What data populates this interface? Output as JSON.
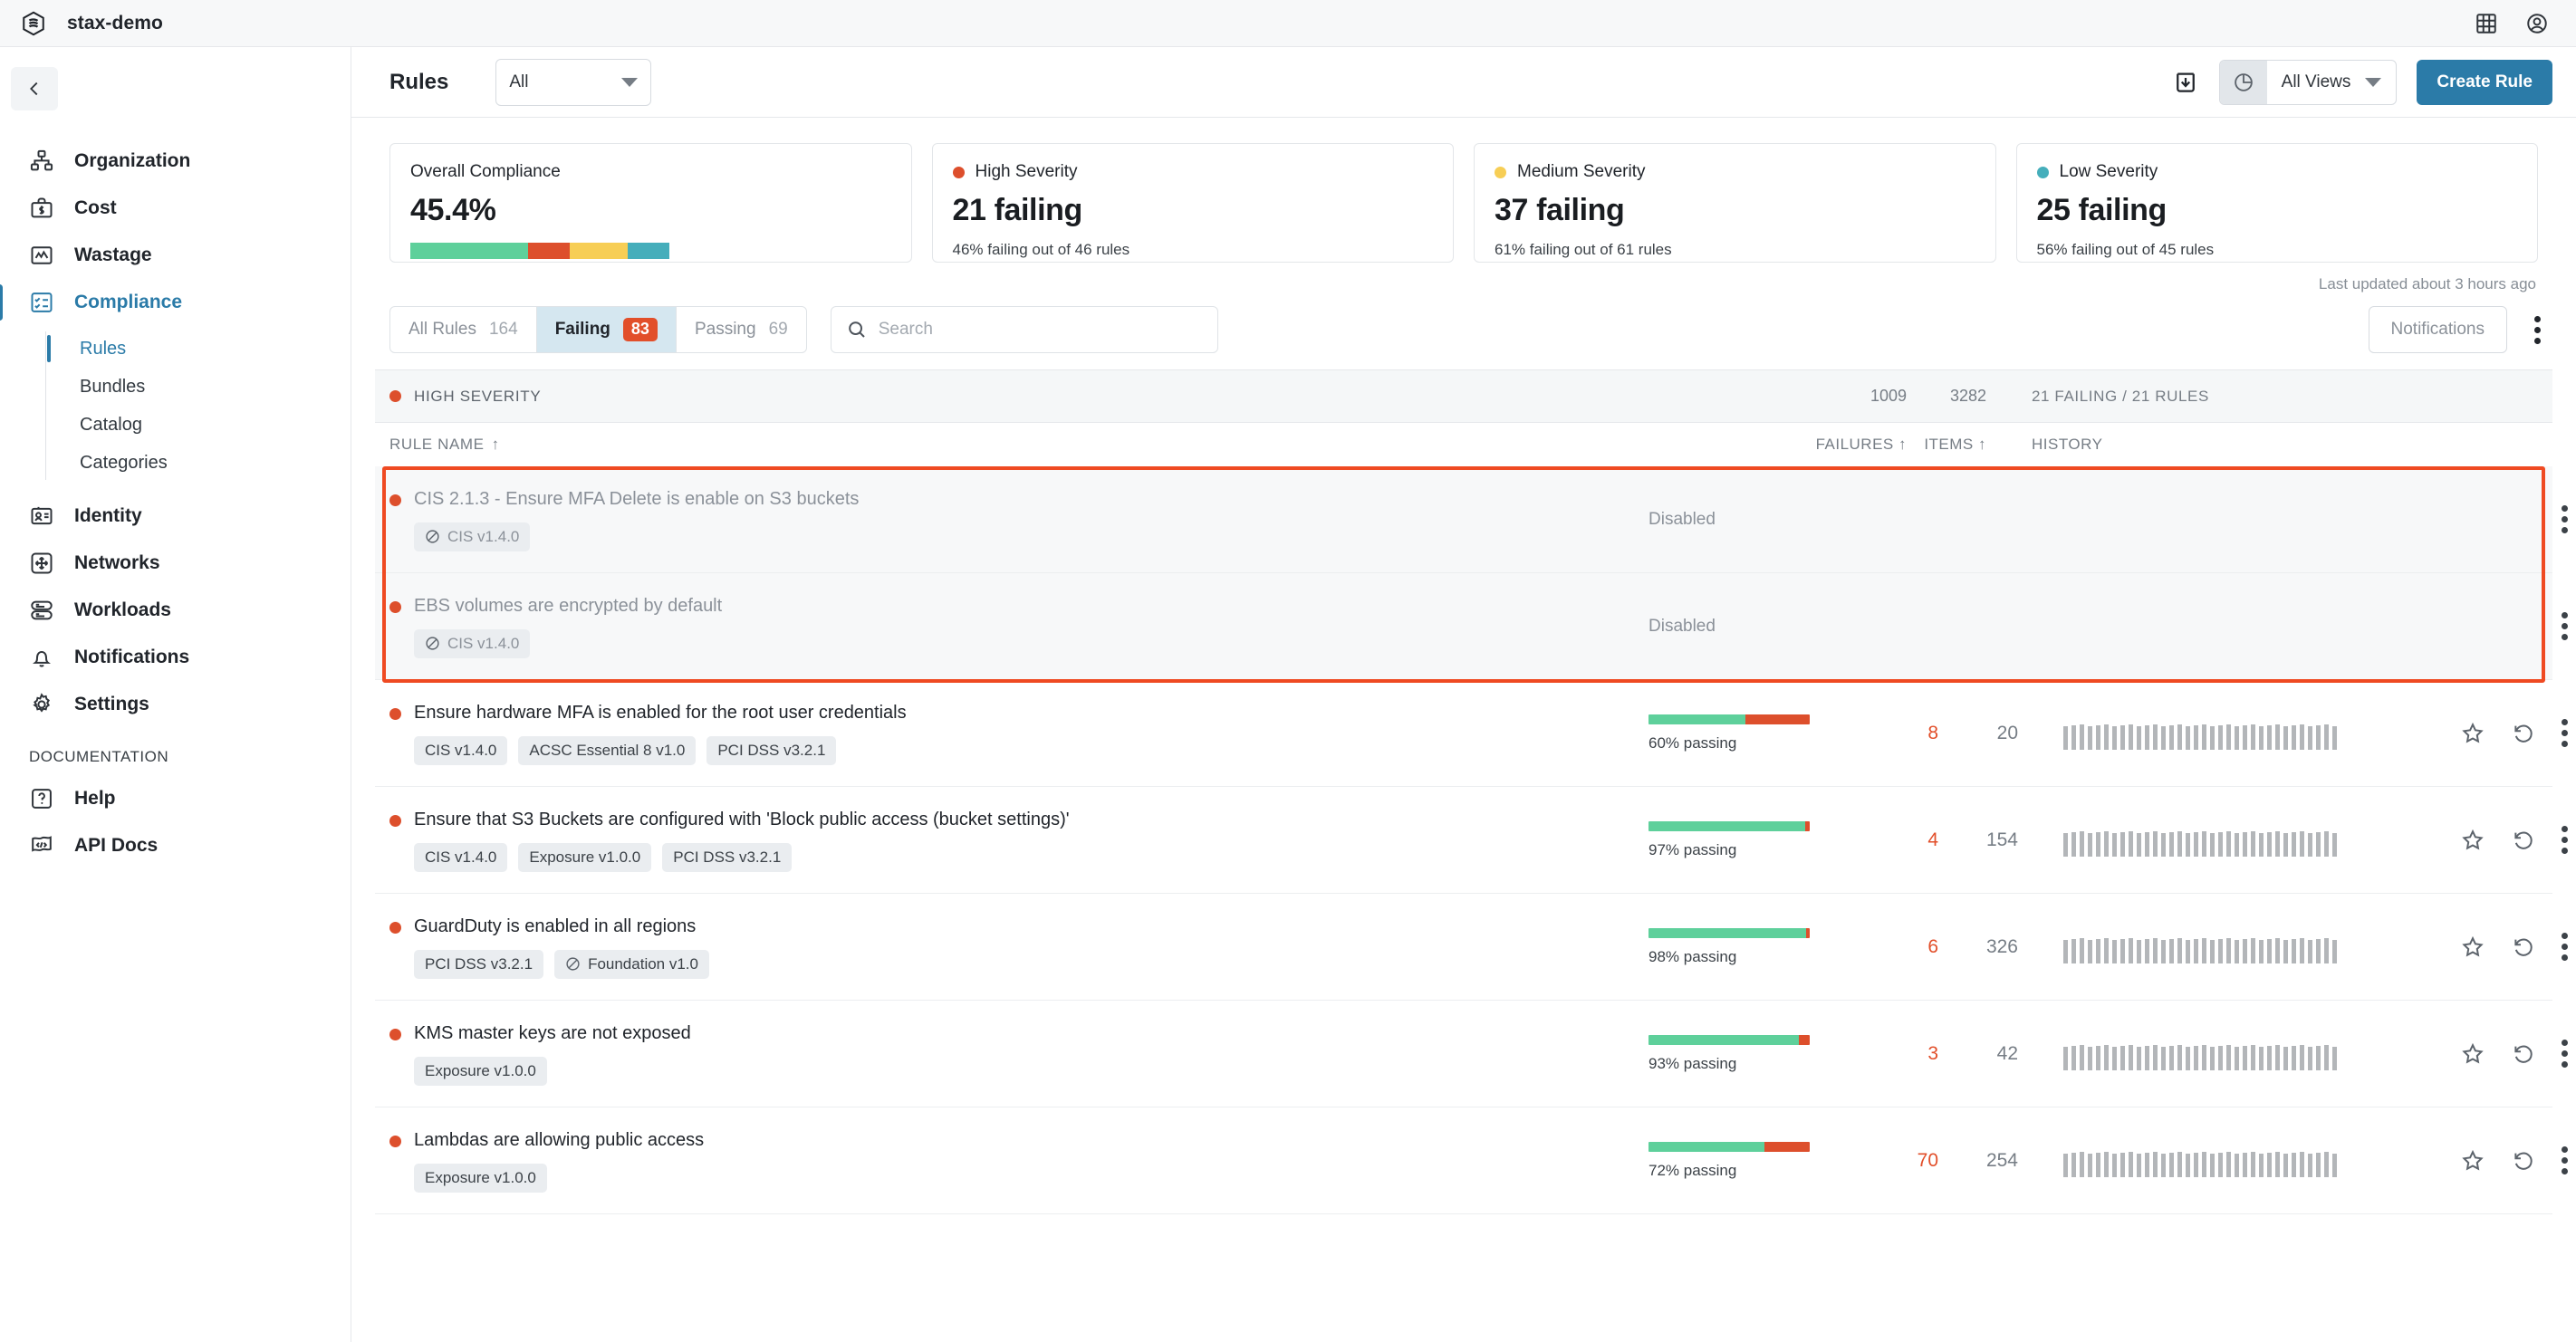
{
  "topbar": {
    "brand_name": "stax-demo",
    "logo_icon": "stax-hexagon-logo",
    "grid_icon": "apps-grid-icon",
    "account_icon": "account-circle-icon"
  },
  "sidebar": {
    "collapse_icon": "chevron-left-icon",
    "items": [
      {
        "label": "Organization",
        "icon": "org-chart-icon"
      },
      {
        "label": "Cost",
        "icon": "briefcase-dollar-icon"
      },
      {
        "label": "Wastage",
        "icon": "chart-line-icon"
      },
      {
        "label": "Compliance",
        "icon": "checklist-icon",
        "active": true
      }
    ],
    "subitems": [
      {
        "label": "Rules",
        "active": true
      },
      {
        "label": "Bundles",
        "active": false
      },
      {
        "label": "Catalog",
        "active": false
      },
      {
        "label": "Categories",
        "active": false
      }
    ],
    "items2": [
      {
        "label": "Identity",
        "icon": "id-card-icon"
      },
      {
        "label": "Networks",
        "icon": "arrows-move-icon"
      },
      {
        "label": "Workloads",
        "icon": "server-stack-icon"
      },
      {
        "label": "Notifications",
        "icon": "bell-icon"
      },
      {
        "label": "Settings",
        "icon": "gear-icon"
      }
    ],
    "section_title": "DOCUMENTATION",
    "items3": [
      {
        "label": "Help",
        "icon": "question-box-icon"
      },
      {
        "label": "API Docs",
        "icon": "code-flag-icon"
      }
    ]
  },
  "header": {
    "title": "Rules",
    "filter_value": "All",
    "download_icon": "download-box-icon",
    "views_icon": "pie-chart-icon",
    "views_label": "All Views",
    "create_button": "Create Rule"
  },
  "cards": [
    {
      "label": "Overall Compliance",
      "value": "45.4%",
      "has_bar": true,
      "segments": [
        {
          "pct": 45.4,
          "color": "#5ed09b"
        },
        {
          "pct": 16.0,
          "color": "#dd4f2c"
        },
        {
          "pct": 22.6,
          "color": "#f7ce55"
        },
        {
          "pct": 16.0,
          "color": "#45aebb"
        }
      ]
    },
    {
      "label": "High Severity",
      "dot": "#dd4f2c",
      "value": "21 failing",
      "sub": "46% failing out of 46 rules"
    },
    {
      "label": "Medium Severity",
      "dot": "#f7ce55",
      "value": "37 failing",
      "sub": "61% failing out of 61 rules"
    },
    {
      "label": "Low Severity",
      "dot": "#45aebb",
      "value": "25 failing",
      "sub": "56% failing out of 45 rules"
    }
  ],
  "last_updated": "Last updated about 3 hours ago",
  "filters": {
    "tabs": [
      {
        "label": "All Rules",
        "count": "164",
        "active": false
      },
      {
        "label": "Failing",
        "badge": "83",
        "active": true
      },
      {
        "label": "Passing",
        "count": "69",
        "active": false
      }
    ],
    "search_placeholder": "Search",
    "search_value": "",
    "search_icon": "search-icon",
    "notifications_button": "Notifications",
    "more_icon": "kebab-menu-icon"
  },
  "table": {
    "severity_header": {
      "label": "HIGH SEVERITY",
      "dot": "#dd4f2c",
      "failures": "1009",
      "items": "3282",
      "ratio": "21 FAILING / 21 RULES"
    },
    "columns": {
      "rule_name": "RULE NAME",
      "rule_sort": "↑",
      "failures": "FAILURES",
      "failures_sort": "↑",
      "items": "ITEMS",
      "items_sort": "↑",
      "history": "HISTORY"
    },
    "rows": [
      {
        "title": "CIS 2.1.3 - Ensure MFA Delete is enable on S3 buckets",
        "dot": "#dd4f2c",
        "tags": [
          {
            "label": "CIS v1.4.0",
            "banned": true
          }
        ],
        "disabled": true,
        "status": "Disabled",
        "highlighted": true
      },
      {
        "title": "EBS volumes are encrypted by default",
        "dot": "#dd4f2c",
        "tags": [
          {
            "label": "CIS v1.4.0",
            "banned": true
          }
        ],
        "disabled": true,
        "status": "Disabled",
        "highlighted": true
      },
      {
        "title": "Ensure hardware MFA is enabled for the root user credentials",
        "dot": "#dd4f2c",
        "tags": [
          {
            "label": "CIS v1.4.0",
            "banned": false
          },
          {
            "label": "ACSC Essential 8 v1.0",
            "banned": false
          },
          {
            "label": "PCI DSS v3.2.1",
            "banned": false
          }
        ],
        "disabled": false,
        "passing_pct": 60,
        "passing_text": "60% passing",
        "failures": "8",
        "items": "20"
      },
      {
        "title": "Ensure that S3 Buckets are configured with 'Block public access (bucket settings)'",
        "dot": "#dd4f2c",
        "tags": [
          {
            "label": "CIS v1.4.0",
            "banned": false
          },
          {
            "label": "Exposure v1.0.0",
            "banned": false
          },
          {
            "label": "PCI DSS v3.2.1",
            "banned": false
          }
        ],
        "disabled": false,
        "passing_pct": 97,
        "passing_text": "97% passing",
        "failures": "4",
        "items": "154"
      },
      {
        "title": "GuardDuty is enabled in all regions",
        "dot": "#dd4f2c",
        "tags": [
          {
            "label": "PCI DSS v3.2.1",
            "banned": false
          },
          {
            "label": "Foundation v1.0",
            "banned": true
          }
        ],
        "disabled": false,
        "passing_pct": 98,
        "passing_text": "98% passing",
        "failures": "6",
        "items": "326"
      },
      {
        "title": "KMS master keys are not exposed",
        "dot": "#dd4f2c",
        "tags": [
          {
            "label": "Exposure v1.0.0",
            "banned": false
          }
        ],
        "disabled": false,
        "passing_pct": 93,
        "passing_text": "93% passing",
        "failures": "3",
        "items": "42"
      },
      {
        "title": "Lambdas are allowing public access",
        "dot": "#dd4f2c",
        "tags": [
          {
            "label": "Exposure v1.0.0",
            "banned": false
          }
        ],
        "disabled": false,
        "passing_pct": 72,
        "passing_text": "72% passing",
        "failures": "70",
        "items": "254"
      }
    ],
    "row_actions": {
      "star_icon": "star-outline-icon",
      "history_icon": "history-revert-icon",
      "menu_icon": "kebab-menu-icon"
    }
  },
  "colors": {
    "accent": "#2b7ba8",
    "danger": "#dd4f2c",
    "pass": "#5ed09b",
    "warn": "#f7ce55",
    "info": "#45aebb"
  }
}
